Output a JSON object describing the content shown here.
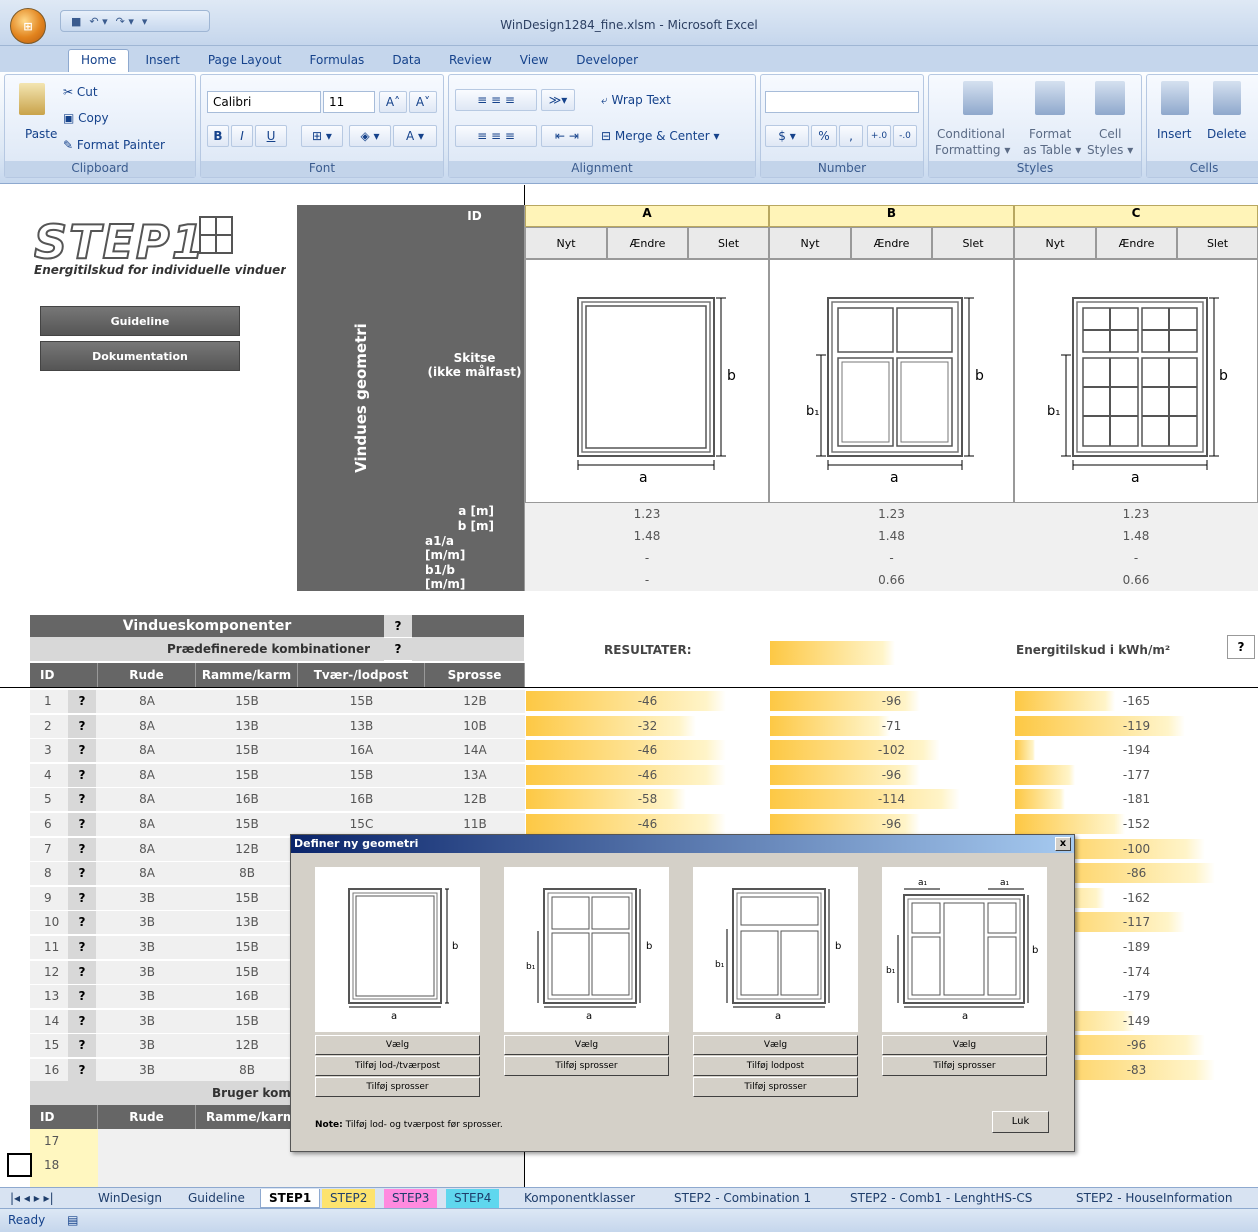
{
  "window": {
    "title": "WinDesign1284_fine.xlsm - Microsoft Excel"
  },
  "ribbon": {
    "tabs": [
      "Home",
      "Insert",
      "Page Layout",
      "Formulas",
      "Data",
      "Review",
      "View",
      "Developer"
    ],
    "clipboard": {
      "label": "Clipboard",
      "paste": "Paste",
      "cut": "Cut",
      "copy": "Copy",
      "format_painter": "Format Painter"
    },
    "font": {
      "label": "Font",
      "name": "Calibri",
      "size": "11",
      "bold": "B",
      "italic": "I",
      "underline": "U"
    },
    "alignment": {
      "label": "Alignment",
      "wrap": "Wrap Text",
      "merge": "Merge & Center"
    },
    "number": {
      "label": "Number",
      "percent": "%",
      "comma": ","
    },
    "styles": {
      "label": "Styles",
      "conditional": "Conditional",
      "formatting": "Formatting",
      "format": "Format",
      "as_table": "as Table",
      "cell": "Cell",
      "cell_styles": "Styles"
    },
    "cells": {
      "label": "Cells",
      "insert": "Insert",
      "delete": "Delete"
    }
  },
  "sheet": {
    "logo": "STEP1",
    "subtitle": "Energitilskud for individuelle vinduer",
    "guideline_btn": "Guideline",
    "doc_btn": "Dokumentation",
    "geometry_title": "Vindues geometri",
    "id_label": "ID",
    "sketch_label1": "Skitse",
    "sketch_label2": "(ikke målfast)",
    "cols": [
      "A",
      "B",
      "C"
    ],
    "actions": [
      "Nyt",
      "Ændre",
      "Slet"
    ],
    "param_labels": [
      "a [m]",
      "b [m]",
      "a1/a [m/m]",
      "b1/b [m/m]"
    ],
    "params": [
      [
        "1.23",
        "1.48",
        "-",
        "-"
      ],
      [
        "1.23",
        "1.48",
        "-",
        "0.66"
      ],
      [
        "1.23",
        "1.48",
        "-",
        "0.66"
      ]
    ],
    "dim_a": "a",
    "dim_b": "b",
    "dim_b1": "b₁",
    "components_title": "Vindueskomponenter",
    "predefined": "Prædefinerede kombinationer",
    "q": "?",
    "comp_headers": [
      "ID",
      "Rude",
      "Ramme/karm",
      "Tvær-/lodpost",
      "Sprosse"
    ],
    "results_label": "RESULTATER:",
    "energy_label": "Energitilskud i  kWh/m²",
    "rows": [
      {
        "id": "1",
        "rude": "8A",
        "ramme": "15B",
        "post": "15B",
        "sprosse": "12B",
        "a": "-46",
        "b": "-96",
        "c": "-165",
        "fa": 1.0,
        "fb": 0.75,
        "fc": 0.5
      },
      {
        "id": "2",
        "rude": "8A",
        "ramme": "13B",
        "post": "13B",
        "sprosse": "10B",
        "a": "-32",
        "b": "-71",
        "c": "-119",
        "fa": 0.85,
        "fb": 0.6,
        "fc": 0.85
      },
      {
        "id": "3",
        "rude": "8A",
        "ramme": "15B",
        "post": "16A",
        "sprosse": "14A",
        "a": "-46",
        "b": "-102",
        "c": "-194",
        "fa": 1.0,
        "fb": 0.85,
        "fc": 0.1
      },
      {
        "id": "4",
        "rude": "8A",
        "ramme": "15B",
        "post": "15B",
        "sprosse": "13A",
        "a": "-46",
        "b": "-96",
        "c": "-177",
        "fa": 1.0,
        "fb": 0.75,
        "fc": 0.3
      },
      {
        "id": "5",
        "rude": "8A",
        "ramme": "16B",
        "post": "16B",
        "sprosse": "12B",
        "a": "-58",
        "b": "-114",
        "c": "-181",
        "fa": 0.8,
        "fb": 0.95,
        "fc": 0.25
      },
      {
        "id": "6",
        "rude": "8A",
        "ramme": "15B",
        "post": "15C",
        "sprosse": "11B",
        "a": "-46",
        "b": "-96",
        "c": "-152",
        "fa": 1.0,
        "fb": 0.75,
        "fc": 0.55
      },
      {
        "id": "7",
        "rude": "8A",
        "ramme": "12B",
        "post": "",
        "sprosse": "",
        "a": "",
        "b": "",
        "c": "-100",
        "fa": 0,
        "fb": 0,
        "fc": 0.95
      },
      {
        "id": "8",
        "rude": "8A",
        "ramme": "8B",
        "post": "",
        "sprosse": "",
        "a": "",
        "b": "",
        "c": "-86",
        "fa": 0,
        "fb": 0,
        "fc": 1.0
      },
      {
        "id": "9",
        "rude": "3B",
        "ramme": "15B",
        "post": "",
        "sprosse": "",
        "a": "",
        "b": "",
        "c": "-162",
        "fa": 0,
        "fb": 0,
        "fc": 0.45
      },
      {
        "id": "10",
        "rude": "3B",
        "ramme": "13B",
        "post": "",
        "sprosse": "",
        "a": "",
        "b": "",
        "c": "-117",
        "fa": 0,
        "fb": 0,
        "fc": 0.85
      },
      {
        "id": "11",
        "rude": "3B",
        "ramme": "15B",
        "post": "",
        "sprosse": "",
        "a": "",
        "b": "",
        "c": "-189",
        "fa": 0,
        "fb": 0,
        "fc": 0.15
      },
      {
        "id": "12",
        "rude": "3B",
        "ramme": "15B",
        "post": "",
        "sprosse": "",
        "a": "",
        "b": "",
        "c": "-174",
        "fa": 0,
        "fb": 0,
        "fc": 0.3
      },
      {
        "id": "13",
        "rude": "3B",
        "ramme": "16B",
        "post": "",
        "sprosse": "",
        "a": "",
        "b": "",
        "c": "-179",
        "fa": 0,
        "fb": 0,
        "fc": 0.25
      },
      {
        "id": "14",
        "rude": "3B",
        "ramme": "15B",
        "post": "",
        "sprosse": "",
        "a": "",
        "b": "",
        "c": "-149",
        "fa": 0,
        "fb": 0,
        "fc": 0.6
      },
      {
        "id": "15",
        "rude": "3B",
        "ramme": "12B",
        "post": "",
        "sprosse": "",
        "a": "",
        "b": "",
        "c": "-96",
        "fa": 0,
        "fb": 0,
        "fc": 0.95
      },
      {
        "id": "16",
        "rude": "3B",
        "ramme": "8B",
        "post": "",
        "sprosse": "",
        "a": "",
        "b": "",
        "c": "-83",
        "fa": 0,
        "fb": 0,
        "fc": 1.0
      }
    ],
    "user_comb": "Bruger komb",
    "user_headers": [
      "ID",
      "Rude",
      "Ramme/karm"
    ],
    "user_rows": [
      "17",
      "18"
    ]
  },
  "dialog": {
    "title": "Definer ny geometri",
    "close": "x",
    "choose": "Vælg",
    "add_post": "Tilføj lod-/tværpost",
    "add_sprosser": "Tilføj sprosser",
    "add_lodpost": "Tilføj lodpost",
    "note_bold": "Note:",
    "note": " Tilføj lod- og tværpost før sprosser.",
    "close_btn": "Luk",
    "a1": "a₁"
  },
  "sheet_tabs": [
    "WinDesign",
    "Guideline",
    "STEP1",
    "STEP2",
    "STEP3",
    "STEP4",
    "Komponentklasser",
    "STEP2 - Combination 1",
    "STEP2 - Comb1 - LenghtHS-CS",
    "STEP2 - HouseInformation"
  ],
  "status": "Ready"
}
